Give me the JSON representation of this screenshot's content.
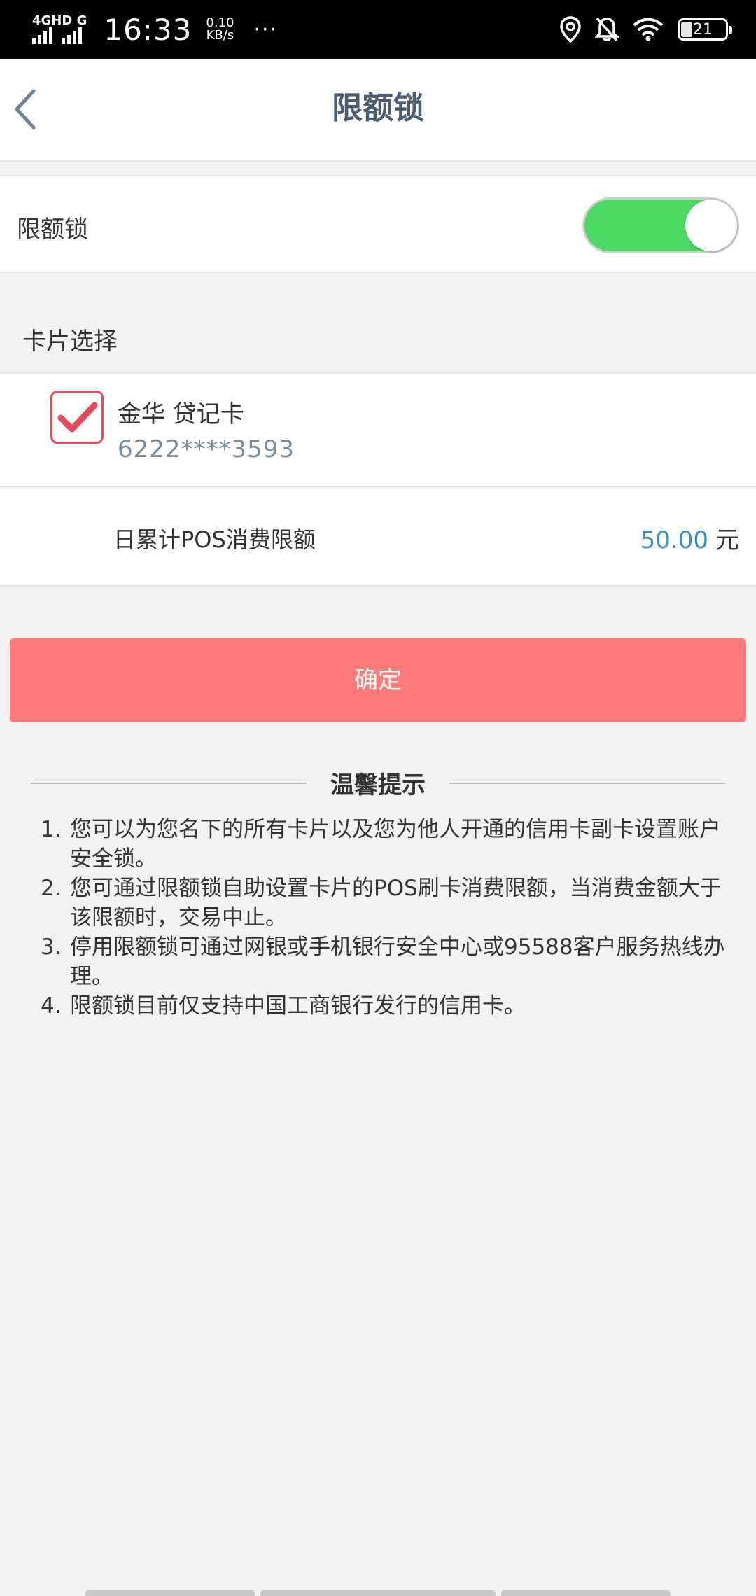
{
  "status_bar": {
    "network": "4GHD G",
    "time": "16:33",
    "speed_value": "0.10",
    "speed_unit": "KB/s",
    "more": "···",
    "battery": "21",
    "icons": [
      "location-icon",
      "bell-off-icon",
      "wifi-icon",
      "battery-icon"
    ]
  },
  "header": {
    "title": "限额锁",
    "back_icon": "chevron-left-icon"
  },
  "toggle_row": {
    "label": "限额锁",
    "enabled": true,
    "on_color": "#4cd964"
  },
  "card_section": {
    "title": "卡片选择",
    "card": {
      "checked": true,
      "name": "金华 贷记卡",
      "number": "6222****3593"
    }
  },
  "limit_row": {
    "label": "日累计POS消费限额",
    "amount": "50.00",
    "unit": "元"
  },
  "confirm": {
    "label": "确定",
    "color": "#ff7b7b"
  },
  "tips": {
    "title": "温馨提示",
    "items": [
      {
        "num": "1.",
        "text": "您可以为您名下的所有卡片以及您为他人开通的信用卡副卡设置账户安全锁。"
      },
      {
        "num": "2.",
        "text": "您可通过限额锁自助设置卡片的POS刷卡消费限额，当消费金额大于该限额时，交易中止。"
      },
      {
        "num": "3.",
        "text": "停用限额锁可通过网银或手机银行安全中心或95588客户服务热线办理。"
      },
      {
        "num": "4.",
        "text": "限额锁目前仅支持中国工商银行发行的信用卡。"
      }
    ]
  }
}
